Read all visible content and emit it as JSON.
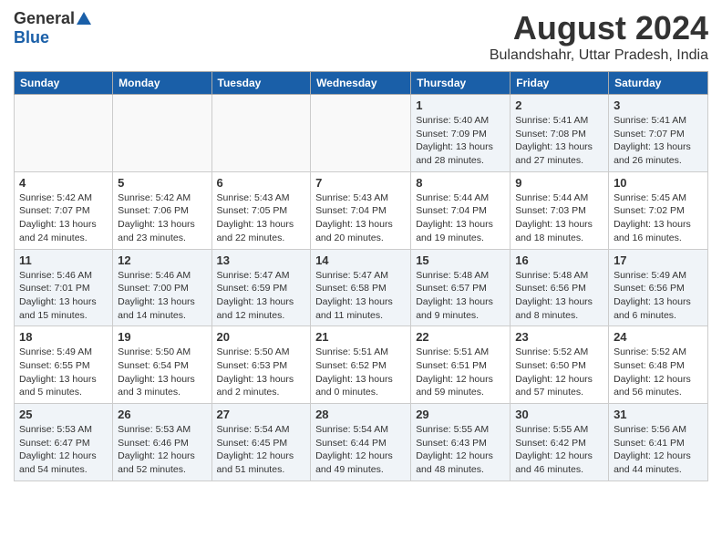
{
  "header": {
    "logo_general": "General",
    "logo_blue": "Blue",
    "month_title": "August 2024",
    "location": "Bulandshahr, Uttar Pradesh, India"
  },
  "days_of_week": [
    "Sunday",
    "Monday",
    "Tuesday",
    "Wednesday",
    "Thursday",
    "Friday",
    "Saturday"
  ],
  "weeks": [
    [
      {
        "day": "",
        "info": ""
      },
      {
        "day": "",
        "info": ""
      },
      {
        "day": "",
        "info": ""
      },
      {
        "day": "",
        "info": ""
      },
      {
        "day": "1",
        "info": "Sunrise: 5:40 AM\nSunset: 7:09 PM\nDaylight: 13 hours\nand 28 minutes."
      },
      {
        "day": "2",
        "info": "Sunrise: 5:41 AM\nSunset: 7:08 PM\nDaylight: 13 hours\nand 27 minutes."
      },
      {
        "day": "3",
        "info": "Sunrise: 5:41 AM\nSunset: 7:07 PM\nDaylight: 13 hours\nand 26 minutes."
      }
    ],
    [
      {
        "day": "4",
        "info": "Sunrise: 5:42 AM\nSunset: 7:07 PM\nDaylight: 13 hours\nand 24 minutes."
      },
      {
        "day": "5",
        "info": "Sunrise: 5:42 AM\nSunset: 7:06 PM\nDaylight: 13 hours\nand 23 minutes."
      },
      {
        "day": "6",
        "info": "Sunrise: 5:43 AM\nSunset: 7:05 PM\nDaylight: 13 hours\nand 22 minutes."
      },
      {
        "day": "7",
        "info": "Sunrise: 5:43 AM\nSunset: 7:04 PM\nDaylight: 13 hours\nand 20 minutes."
      },
      {
        "day": "8",
        "info": "Sunrise: 5:44 AM\nSunset: 7:04 PM\nDaylight: 13 hours\nand 19 minutes."
      },
      {
        "day": "9",
        "info": "Sunrise: 5:44 AM\nSunset: 7:03 PM\nDaylight: 13 hours\nand 18 minutes."
      },
      {
        "day": "10",
        "info": "Sunrise: 5:45 AM\nSunset: 7:02 PM\nDaylight: 13 hours\nand 16 minutes."
      }
    ],
    [
      {
        "day": "11",
        "info": "Sunrise: 5:46 AM\nSunset: 7:01 PM\nDaylight: 13 hours\nand 15 minutes."
      },
      {
        "day": "12",
        "info": "Sunrise: 5:46 AM\nSunset: 7:00 PM\nDaylight: 13 hours\nand 14 minutes."
      },
      {
        "day": "13",
        "info": "Sunrise: 5:47 AM\nSunset: 6:59 PM\nDaylight: 13 hours\nand 12 minutes."
      },
      {
        "day": "14",
        "info": "Sunrise: 5:47 AM\nSunset: 6:58 PM\nDaylight: 13 hours\nand 11 minutes."
      },
      {
        "day": "15",
        "info": "Sunrise: 5:48 AM\nSunset: 6:57 PM\nDaylight: 13 hours\nand 9 minutes."
      },
      {
        "day": "16",
        "info": "Sunrise: 5:48 AM\nSunset: 6:56 PM\nDaylight: 13 hours\nand 8 minutes."
      },
      {
        "day": "17",
        "info": "Sunrise: 5:49 AM\nSunset: 6:56 PM\nDaylight: 13 hours\nand 6 minutes."
      }
    ],
    [
      {
        "day": "18",
        "info": "Sunrise: 5:49 AM\nSunset: 6:55 PM\nDaylight: 13 hours\nand 5 minutes."
      },
      {
        "day": "19",
        "info": "Sunrise: 5:50 AM\nSunset: 6:54 PM\nDaylight: 13 hours\nand 3 minutes."
      },
      {
        "day": "20",
        "info": "Sunrise: 5:50 AM\nSunset: 6:53 PM\nDaylight: 13 hours\nand 2 minutes."
      },
      {
        "day": "21",
        "info": "Sunrise: 5:51 AM\nSunset: 6:52 PM\nDaylight: 13 hours\nand 0 minutes."
      },
      {
        "day": "22",
        "info": "Sunrise: 5:51 AM\nSunset: 6:51 PM\nDaylight: 12 hours\nand 59 minutes."
      },
      {
        "day": "23",
        "info": "Sunrise: 5:52 AM\nSunset: 6:50 PM\nDaylight: 12 hours\nand 57 minutes."
      },
      {
        "day": "24",
        "info": "Sunrise: 5:52 AM\nSunset: 6:48 PM\nDaylight: 12 hours\nand 56 minutes."
      }
    ],
    [
      {
        "day": "25",
        "info": "Sunrise: 5:53 AM\nSunset: 6:47 PM\nDaylight: 12 hours\nand 54 minutes."
      },
      {
        "day": "26",
        "info": "Sunrise: 5:53 AM\nSunset: 6:46 PM\nDaylight: 12 hours\nand 52 minutes."
      },
      {
        "day": "27",
        "info": "Sunrise: 5:54 AM\nSunset: 6:45 PM\nDaylight: 12 hours\nand 51 minutes."
      },
      {
        "day": "28",
        "info": "Sunrise: 5:54 AM\nSunset: 6:44 PM\nDaylight: 12 hours\nand 49 minutes."
      },
      {
        "day": "29",
        "info": "Sunrise: 5:55 AM\nSunset: 6:43 PM\nDaylight: 12 hours\nand 48 minutes."
      },
      {
        "day": "30",
        "info": "Sunrise: 5:55 AM\nSunset: 6:42 PM\nDaylight: 12 hours\nand 46 minutes."
      },
      {
        "day": "31",
        "info": "Sunrise: 5:56 AM\nSunset: 6:41 PM\nDaylight: 12 hours\nand 44 minutes."
      }
    ]
  ]
}
